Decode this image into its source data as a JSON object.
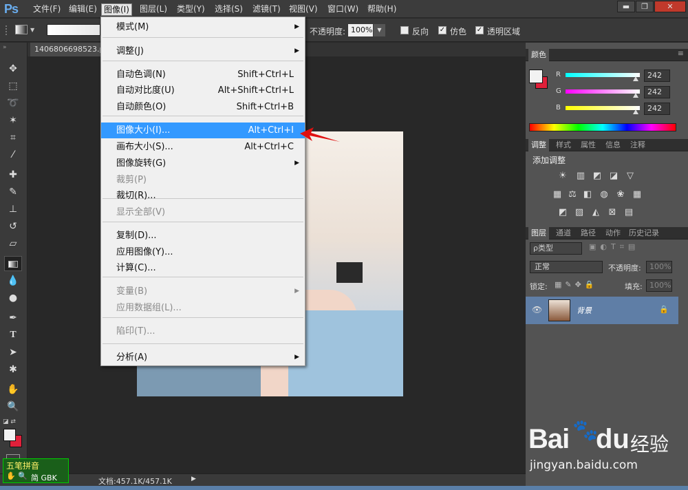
{
  "app": {
    "logo": "Ps"
  },
  "menubar": {
    "items": [
      "文件(F)",
      "编辑(E)",
      "图像(I)",
      "图层(L)",
      "类型(Y)",
      "选择(S)",
      "滤镜(T)",
      "视图(V)",
      "窗口(W)",
      "帮助(H)"
    ],
    "active_index": 2
  },
  "window_controls": {
    "minimize": "▬",
    "restore": "❐",
    "close": "✕"
  },
  "options": {
    "opacity_label": "不透明度:",
    "opacity_value": "100%",
    "reverse_label": "反向",
    "dither_label": "仿色",
    "transparency_label": "透明区域"
  },
  "document": {
    "tab_title": "1406806698523.p",
    "status": "文档:457.1K/457.1K"
  },
  "image_menu": {
    "items": [
      {
        "label": "模式(M)",
        "shortcut": "",
        "submenu": true,
        "disabled": false
      },
      {
        "label": "调整(J)",
        "shortcut": "",
        "submenu": true,
        "disabled": false
      },
      {
        "label": "自动色调(N)",
        "shortcut": "Shift+Ctrl+L",
        "submenu": false,
        "disabled": false
      },
      {
        "label": "自动对比度(U)",
        "shortcut": "Alt+Shift+Ctrl+L",
        "submenu": false,
        "disabled": false
      },
      {
        "label": "自动颜色(O)",
        "shortcut": "Shift+Ctrl+B",
        "submenu": false,
        "disabled": false
      },
      {
        "label": "图像大小(I)...",
        "shortcut": "Alt+Ctrl+I",
        "submenu": false,
        "disabled": false,
        "highlighted": true
      },
      {
        "label": "画布大小(S)...",
        "shortcut": "Alt+Ctrl+C",
        "submenu": false,
        "disabled": false
      },
      {
        "label": "图像旋转(G)",
        "shortcut": "",
        "submenu": true,
        "disabled": false
      },
      {
        "label": "裁剪(P)",
        "shortcut": "",
        "submenu": false,
        "disabled": true
      },
      {
        "label": "裁切(R)...",
        "shortcut": "",
        "submenu": false,
        "disabled": false
      },
      {
        "label": "显示全部(V)",
        "shortcut": "",
        "submenu": false,
        "disabled": true
      },
      {
        "label": "复制(D)...",
        "shortcut": "",
        "submenu": false,
        "disabled": false
      },
      {
        "label": "应用图像(Y)...",
        "shortcut": "",
        "submenu": false,
        "disabled": false
      },
      {
        "label": "计算(C)...",
        "shortcut": "",
        "submenu": false,
        "disabled": false
      },
      {
        "label": "变量(B)",
        "shortcut": "",
        "submenu": true,
        "disabled": true
      },
      {
        "label": "应用数据组(L)...",
        "shortcut": "",
        "submenu": false,
        "disabled": true
      },
      {
        "label": "陷印(T)...",
        "shortcut": "",
        "submenu": false,
        "disabled": true
      },
      {
        "label": "分析(A)",
        "shortcut": "",
        "submenu": true,
        "disabled": false
      }
    ]
  },
  "color_panel": {
    "tab": "颜色",
    "channels": [
      {
        "name": "R",
        "value": "242"
      },
      {
        "name": "G",
        "value": "242"
      },
      {
        "name": "B",
        "value": "242"
      }
    ],
    "foreground": "#f2f2f2",
    "background": "#e0203a"
  },
  "adjust_panel": {
    "tabs": [
      "调整",
      "样式",
      "属性",
      "信息",
      "注释"
    ],
    "title": "添加调整"
  },
  "layers_panel": {
    "tabs": [
      "图层",
      "通道",
      "路径",
      "动作",
      "历史记录"
    ],
    "filter_label": "ρ类型",
    "blend_mode": "正常",
    "opacity_label": "不透明度:",
    "opacity_value": "100%",
    "lock_label": "锁定:",
    "fill_label": "填充:",
    "fill_value": "100%",
    "layer_name": "背景"
  },
  "ime": {
    "title": "五笔拼音",
    "status": "简 GBK"
  },
  "watermark": {
    "brand": "Bai",
    "brand2": "du",
    "text": "经验",
    "url": "jingyan.baidu.com"
  }
}
